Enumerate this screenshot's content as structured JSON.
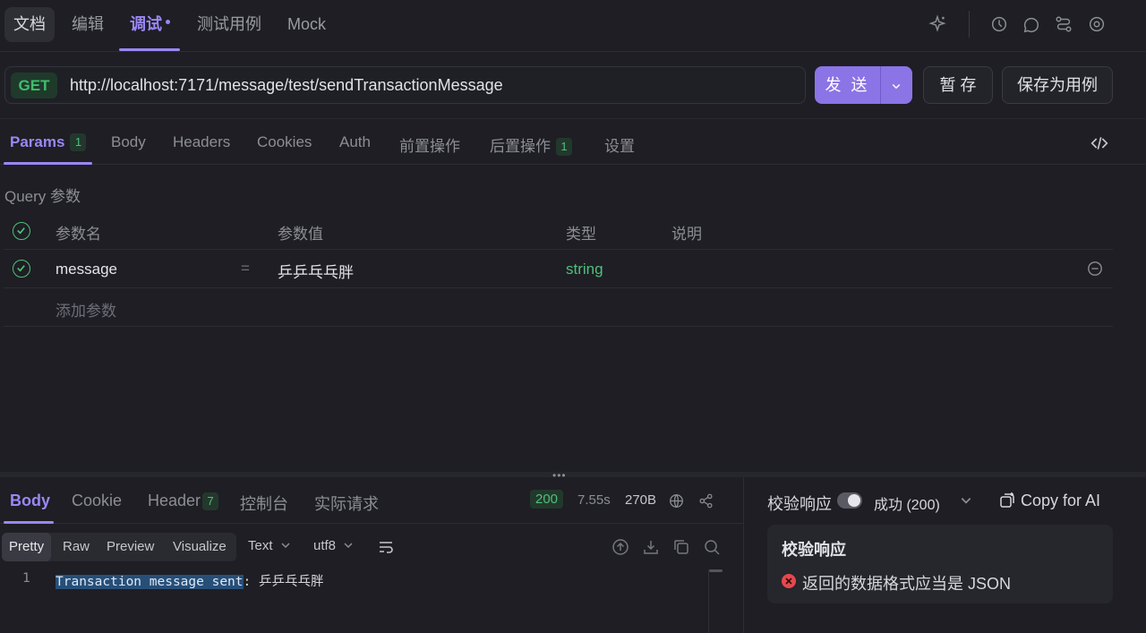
{
  "top_tabs": [
    {
      "label": "文档"
    },
    {
      "label": "编辑"
    },
    {
      "label": "调试"
    },
    {
      "label": "测试用例"
    },
    {
      "label": "Mock"
    }
  ],
  "request": {
    "method": "GET",
    "url": "http://localhost:7171/message/test/sendTransactionMessage",
    "send_label": "发 送",
    "save_label": "暂 存",
    "save_case_label": "保存为用例"
  },
  "param_tabs": {
    "params": "Params",
    "params_count": "1",
    "body": "Body",
    "headers": "Headers",
    "cookies": "Cookies",
    "auth": "Auth",
    "pre": "前置操作",
    "post": "后置操作",
    "post_count": "1",
    "settings": "设置"
  },
  "query": {
    "label": "Query 参数",
    "headers": {
      "name": "参数名",
      "value": "参数值",
      "type": "类型",
      "desc": "说明"
    },
    "rows": [
      {
        "name": "message",
        "eq": "=",
        "value": "乒乒乓乓胖",
        "type": "string"
      }
    ],
    "add_placeholder": "添加参数"
  },
  "response": {
    "tabs": {
      "body": "Body",
      "cookie": "Cookie",
      "header": "Header",
      "header_count": "7",
      "console": "控制台",
      "actual": "实际请求"
    },
    "status": "200",
    "time": "7.55s",
    "size": "270B",
    "view_modes": {
      "pretty": "Pretty",
      "raw": "Raw",
      "preview": "Preview",
      "visualize": "Visualize"
    },
    "format": "Text",
    "encoding": "utf8",
    "line_no": "1",
    "code_highlight": "Transaction message sent",
    "code_rest": ": 乒乒乓乓胖"
  },
  "validation": {
    "toggle_label": "校验响应",
    "toggle_on": true,
    "status_select": "成功 (200)",
    "copy_ai": "Copy for AI",
    "box_title": "校验响应",
    "error_text": "返回的数据格式应当是 JSON"
  },
  "colors": {
    "accent": "#9b87f5",
    "success": "#4ec07a",
    "error": "#e5484d"
  }
}
